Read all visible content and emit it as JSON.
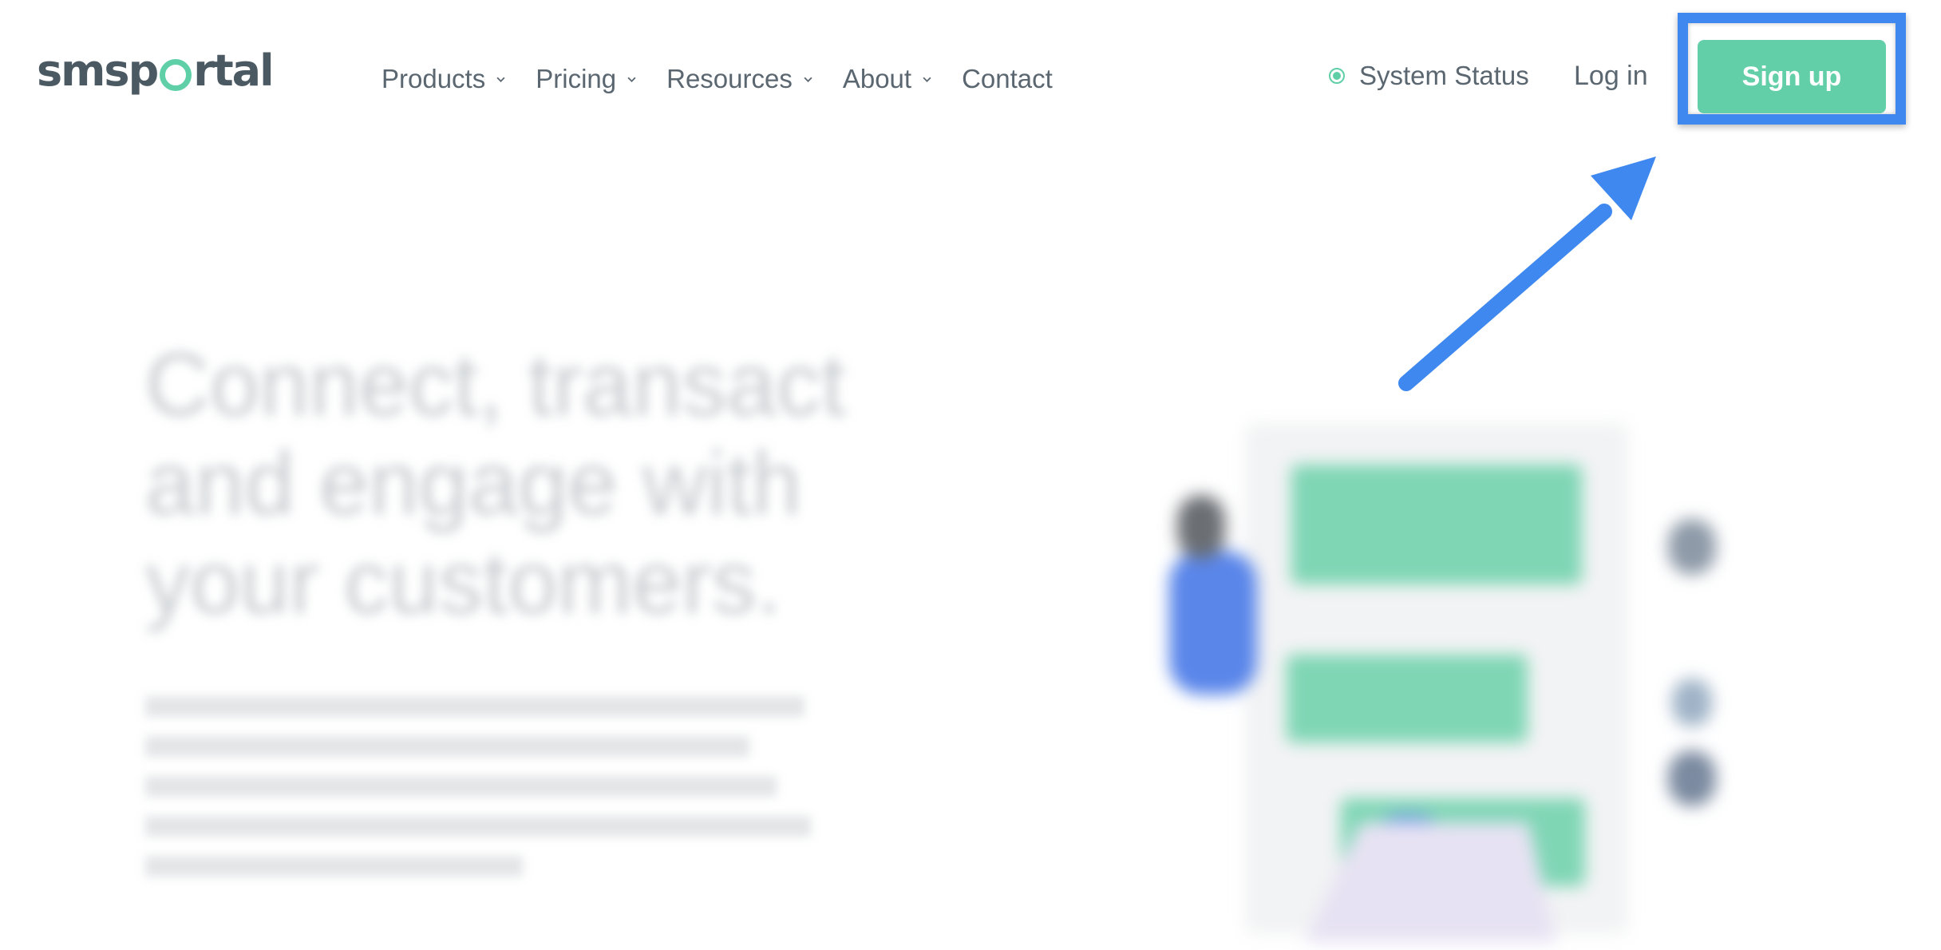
{
  "header": {
    "logo": {
      "text_before": "sms",
      "text_o": "o",
      "text_after": "rtal",
      "accent_color": "#5fcfa7",
      "full": "smsportal"
    },
    "nav": [
      {
        "label": "Products",
        "has_dropdown": true
      },
      {
        "label": "Pricing",
        "has_dropdown": true
      },
      {
        "label": "Resources",
        "has_dropdown": true
      },
      {
        "label": "About",
        "has_dropdown": true
      },
      {
        "label": "Contact",
        "has_dropdown": false
      }
    ],
    "system_status": {
      "label": "System Status",
      "indicator_color": "#5fcfa7"
    },
    "login_label": "Log in",
    "signup_label": "Sign up",
    "signup_color": "#63cfa8"
  },
  "annotation": {
    "highlight_color": "#3f88ef",
    "arrow_color": "#3f88ef"
  },
  "hero": {
    "title": "Connect, transact and engage with your customers.",
    "body": "",
    "blurred": true
  }
}
